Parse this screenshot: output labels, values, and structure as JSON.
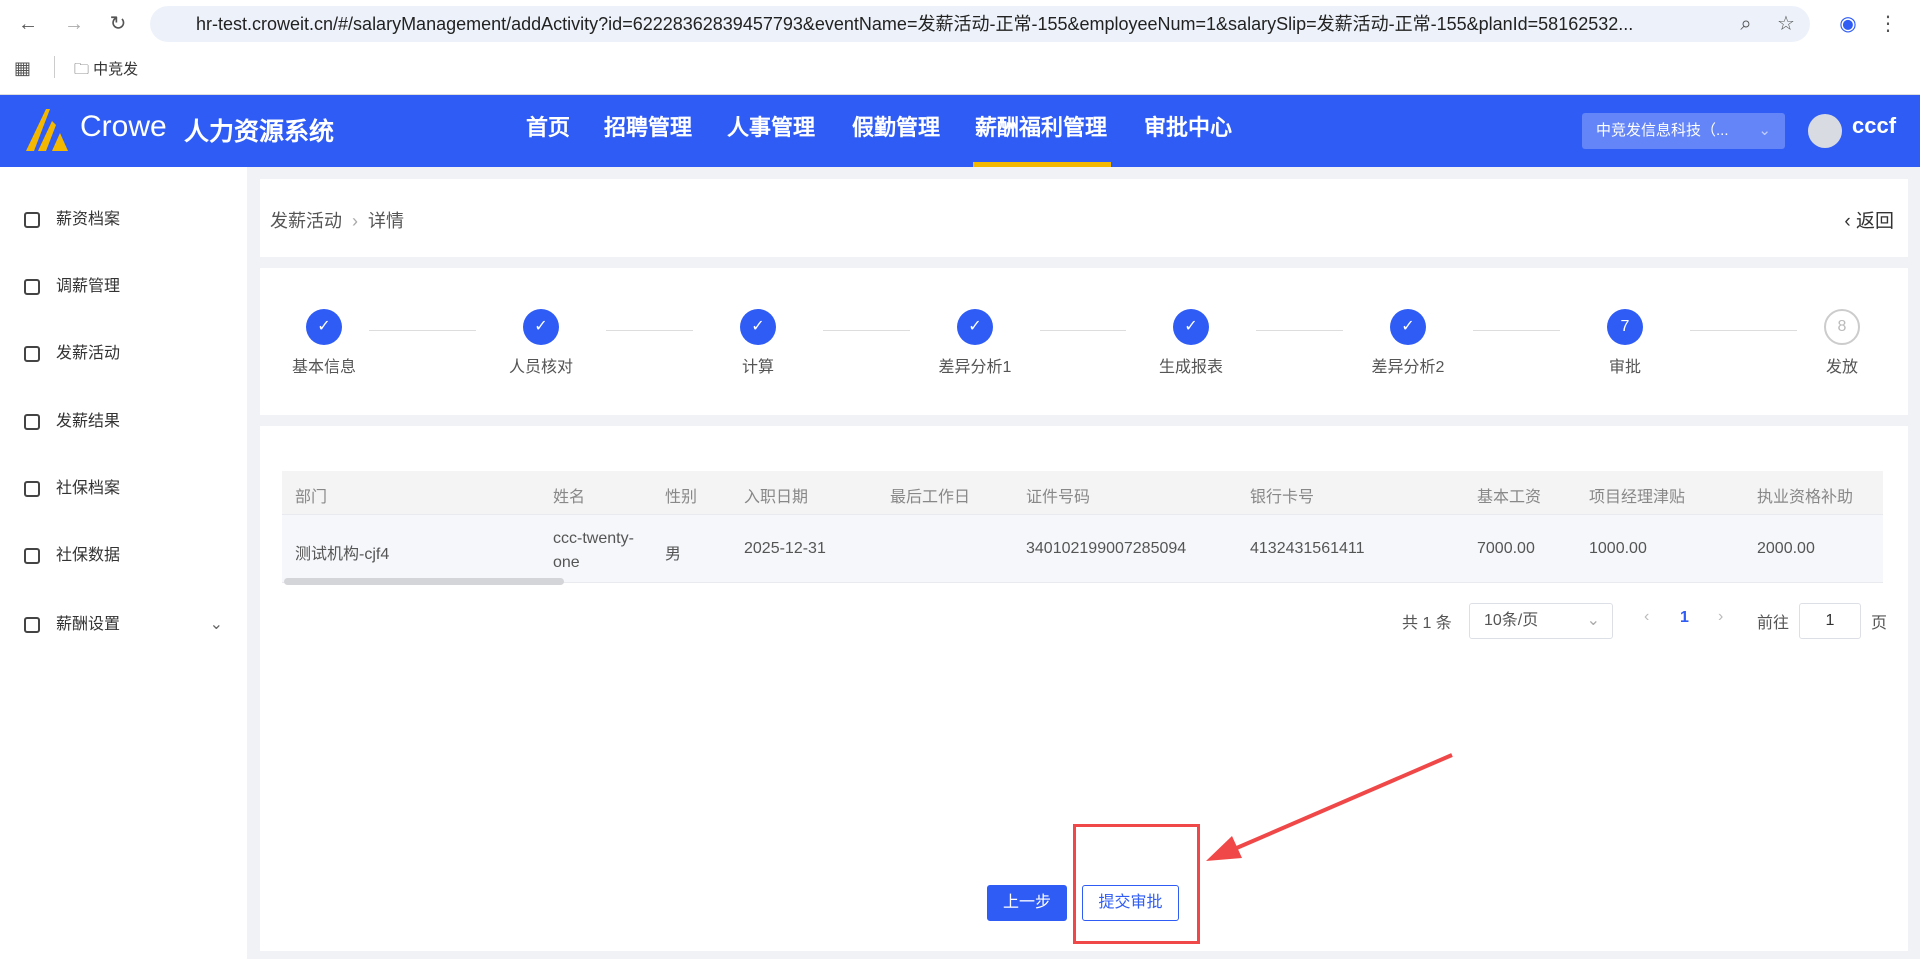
{
  "browser": {
    "url": "hr-test.croweit.cn/#/salaryManagement/addActivity?id=62228362839457793&eventName=发薪活动-正常-155&employeeNum=1&salarySlip=发薪活动-正常-155&planId=58162532...",
    "bookmark": "中竞发"
  },
  "header": {
    "logo": "Crowe",
    "system": "人力资源系统",
    "menu": [
      "首页",
      "招聘管理",
      "人事管理",
      "假勤管理",
      "薪酬福利管理",
      "审批中心"
    ],
    "active_menu": 4,
    "company": "中竞发信息科技（...",
    "user": "cccf"
  },
  "sidebar": {
    "items": [
      "薪资档案",
      "调薪管理",
      "发薪活动",
      "发薪结果",
      "社保档案",
      "社保数据",
      "薪酬设置"
    ]
  },
  "breadcrumb": {
    "parent": "发薪活动",
    "current": "详情",
    "back": "返回"
  },
  "steps": [
    {
      "label": "基本信息",
      "state": "done"
    },
    {
      "label": "人员核对",
      "state": "done"
    },
    {
      "label": "计算",
      "state": "done"
    },
    {
      "label": "差异分析1",
      "state": "done"
    },
    {
      "label": "生成报表",
      "state": "done"
    },
    {
      "label": "差异分析2",
      "state": "done"
    },
    {
      "label": "审批",
      "state": "active",
      "num": "7"
    },
    {
      "label": "发放",
      "state": "pending",
      "num": "8"
    }
  ],
  "table": {
    "headers": [
      "部门",
      "姓名",
      "性别",
      "入职日期",
      "最后工作日",
      "证件号码",
      "银行卡号",
      "基本工资",
      "项目经理津贴",
      "执业资格补助"
    ],
    "rows": [
      [
        "测试机构-cjf4",
        "ccc-twenty-one",
        "男",
        "2025-12-31",
        "",
        "340102199007285094",
        "4132431561411",
        "7000.00",
        "1000.00",
        "2000.00"
      ]
    ]
  },
  "pagination": {
    "total": "共 1 条",
    "page_size": "10条/页",
    "current": "1",
    "goto_label": "前往",
    "goto_value": "1",
    "page_unit": "页"
  },
  "actions": {
    "prev": "上一步",
    "submit": "提交审批"
  },
  "colors": {
    "primary": "#2f5cf5",
    "accent": "#f5b800",
    "highlight": "#f04848"
  }
}
